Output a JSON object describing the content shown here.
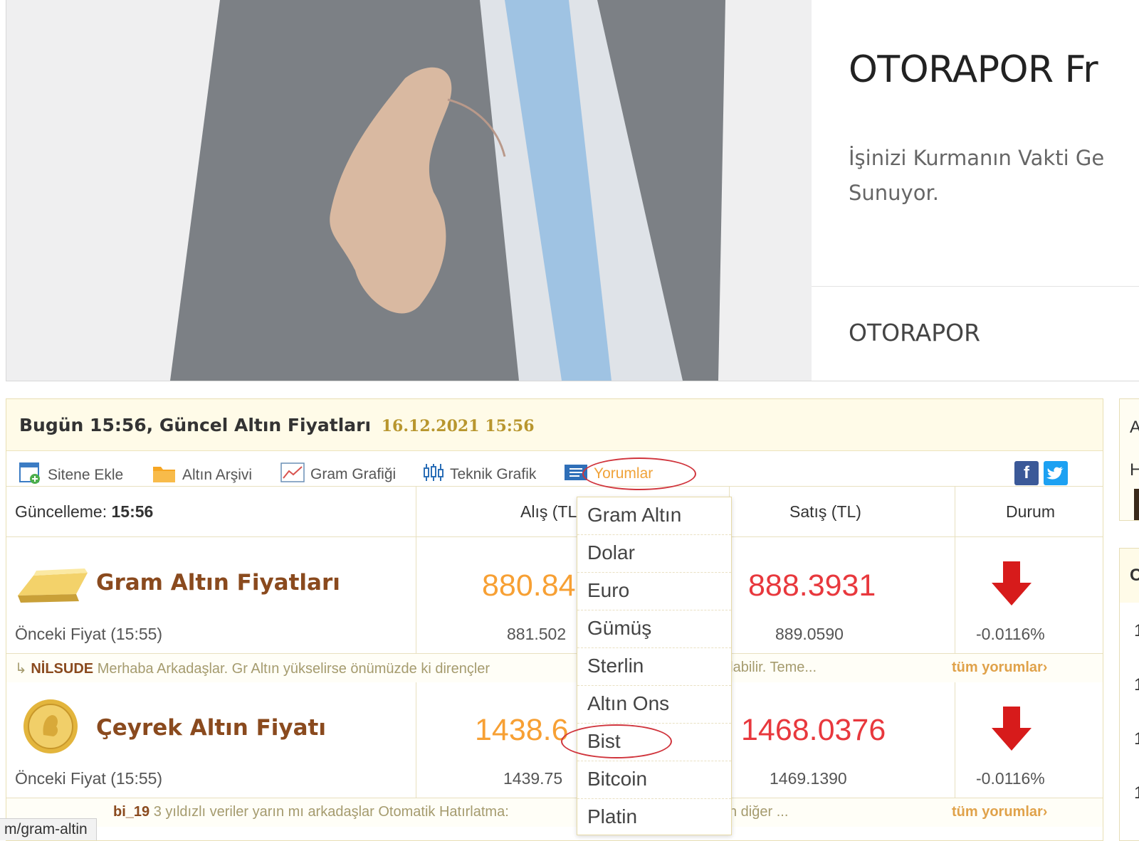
{
  "banner": {
    "title": "OTORAPOR Fr",
    "subtitle_line1": "İşinizi Kurmanın Vakti Ge",
    "subtitle_line2": "Sunuyor.",
    "brand": "OTORAPOR"
  },
  "widget": {
    "title": "Bugün 15:56, Güncel Altın Fiyatları",
    "date": "16.12.2021 15:56",
    "toolbar": [
      {
        "label": "Sitene Ekle",
        "icon": "add-page-icon"
      },
      {
        "label": "Altın Arşivi",
        "icon": "folder-icon"
      },
      {
        "label": "Gram Grafiği",
        "icon": "line-chart-icon"
      },
      {
        "label": "Teknik Grafik",
        "icon": "candlestick-icon"
      },
      {
        "label": "Yorumlar",
        "icon": "comments-icon"
      }
    ],
    "social": {
      "facebook": "f",
      "twitter": "twitter-bird-icon"
    },
    "table_header": {
      "update_label": "Güncelleme:",
      "update_time": "15:56",
      "buy_label": "Alış (TL)",
      "sell_label": "Satış (TL)",
      "status_label": "Durum"
    },
    "rows": [
      {
        "name": "Gram Altın Fiyatları",
        "buy": "880.84",
        "sell": "888.3931",
        "prev_label": "Önceki Fiyat (15:55)",
        "prev_buy": "881.502",
        "prev_sell": "889.0590",
        "change": "-0.0116%",
        "comment_user": "NİLSUDE",
        "comment_text": "Merhaba Arkadaşlar. Gr Altın yükselirse önümüzde ki dirençler",
        "comment_tail": "olabilir. Teme...",
        "comment_more": "tüm yorumlar›"
      },
      {
        "name": "Çeyrek Altın Fiyatı",
        "buy": "1438.6",
        "sell": "1468.0376",
        "prev_label": "Önceki Fiyat (15:55)",
        "prev_buy": "1439.75",
        "prev_sell": "1469.1390",
        "change": "-0.0116%",
        "comment_user": "bi_19",
        "comment_text": "3 yıldızlı veriler yarın mı arkadaşlar Otomatik Hatırlatma:",
        "comment_tail": "n diğer ...",
        "comment_more": "tüm yorumlar›"
      }
    ]
  },
  "dropdown": [
    "Gram Altın",
    "Dolar",
    "Euro",
    "Gümüş",
    "Sterlin",
    "Altın Ons",
    "Bist",
    "Bitcoin",
    "Platin"
  ],
  "side": {
    "a": "A",
    "h": "H",
    "c": "C",
    "n1": "1",
    "n2": "1",
    "n3": "1",
    "n4": "1"
  },
  "status_url": "m/gram-altin",
  "colors": {
    "accent_orange": "#f7a034",
    "price_red": "#e8383d",
    "highlight_oval": "#d0343c",
    "header_bg": "#fffbe8"
  }
}
